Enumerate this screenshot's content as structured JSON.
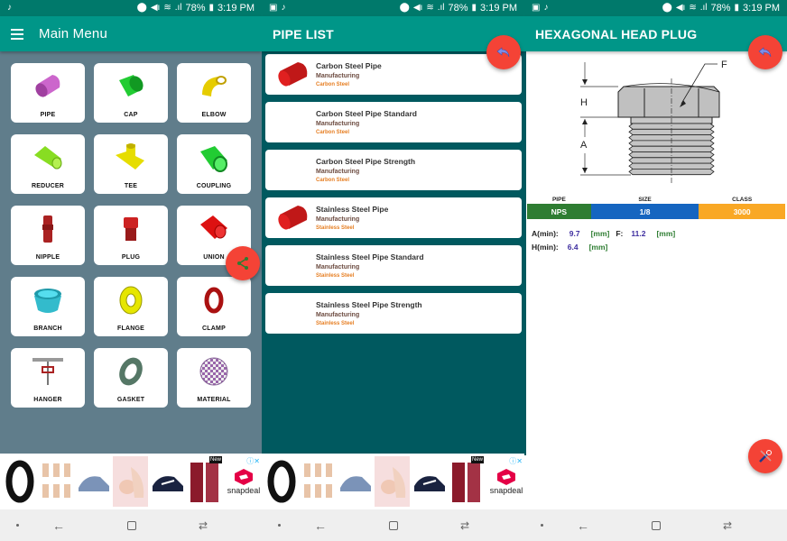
{
  "status_bar": {
    "battery": "78%",
    "time": "3:19 PM"
  },
  "main_menu": {
    "title": "Main Menu",
    "items": [
      {
        "label": "PIPE",
        "icon": "pipe-icon",
        "color": "#cc66cc"
      },
      {
        "label": "CAP",
        "icon": "cap-icon",
        "color": "#22cc33"
      },
      {
        "label": "ELBOW",
        "icon": "elbow-icon",
        "color": "#e6cc00"
      },
      {
        "label": "REDUCER",
        "icon": "reducer-icon",
        "color": "#88dd22"
      },
      {
        "label": "TEE",
        "icon": "tee-icon",
        "color": "#e6dd00"
      },
      {
        "label": "COUPLING",
        "icon": "coupling-icon",
        "color": "#22cc33"
      },
      {
        "label": "NIPPLE",
        "icon": "nipple-icon",
        "color": "#aa2222"
      },
      {
        "label": "PLUG",
        "icon": "plug-icon",
        "color": "#bb2222"
      },
      {
        "label": "UNION",
        "icon": "union-icon",
        "color": "#dd1111"
      },
      {
        "label": "BRANCH",
        "icon": "branch-icon",
        "color": "#33bbcc"
      },
      {
        "label": "FLANGE",
        "icon": "flange-icon",
        "color": "#e6e600"
      },
      {
        "label": "CLAMP",
        "icon": "clamp-icon",
        "color": "#aa1111"
      },
      {
        "label": "HANGER",
        "icon": "hanger-icon",
        "color": "#888888"
      },
      {
        "label": "GASKET",
        "icon": "gasket-icon",
        "color": "#557766"
      },
      {
        "label": "MATERIAL",
        "icon": "material-icon",
        "color": "#9966aa"
      }
    ],
    "fab_icon": "share-icon"
  },
  "pipe_list": {
    "title": "PIPE LIST",
    "fab_icon": "back-reply-icon",
    "items": [
      {
        "title": "Carbon Steel Pipe",
        "category": "Manufacturing",
        "material": "Carbon Steel",
        "has_image": true
      },
      {
        "title": "Carbon Steel Pipe Standard",
        "category": "Manufacturing",
        "material": "Carbon Steel",
        "has_image": false
      },
      {
        "title": "Carbon Steel Pipe Strength",
        "category": "Manufacturing",
        "material": "Carbon Steel",
        "has_image": false
      },
      {
        "title": "Stainless Steel Pipe",
        "category": "Manufacturing",
        "material": "Stainless Steel",
        "has_image": true
      },
      {
        "title": "Stainless Steel Pipe Standard",
        "category": "Manufacturing",
        "material": "Stainless Steel",
        "has_image": false
      },
      {
        "title": "Stainless Steel Pipe Strength",
        "category": "Manufacturing",
        "material": "Stainless Steel",
        "has_image": false
      }
    ]
  },
  "detail": {
    "title": "HEXAGONAL HEAD PLUG",
    "fab_icon": "back-reply-icon",
    "tools_fab_icon": "tools-icon",
    "drawing_labels": {
      "h": "H",
      "a": "A",
      "f": "F"
    },
    "table": {
      "headers": [
        "PIPE",
        "SIZE",
        "CLASS"
      ],
      "values": [
        "NPS",
        "1/8",
        "3000"
      ]
    },
    "measurements": {
      "a_label": "A(min):",
      "a_value": "9.7",
      "a_unit": "[mm]",
      "f_label": "F:",
      "f_value": "11.2",
      "f_unit": "[mm]",
      "h_label": "H(min):",
      "h_value": "6.4",
      "h_unit": "[mm]"
    }
  },
  "ad": {
    "brand": "snapdeal",
    "badge": "New",
    "info_icon": "ⓘ",
    "close_icon": "✕"
  },
  "nav": {
    "back": "←",
    "recent": "⇄"
  }
}
